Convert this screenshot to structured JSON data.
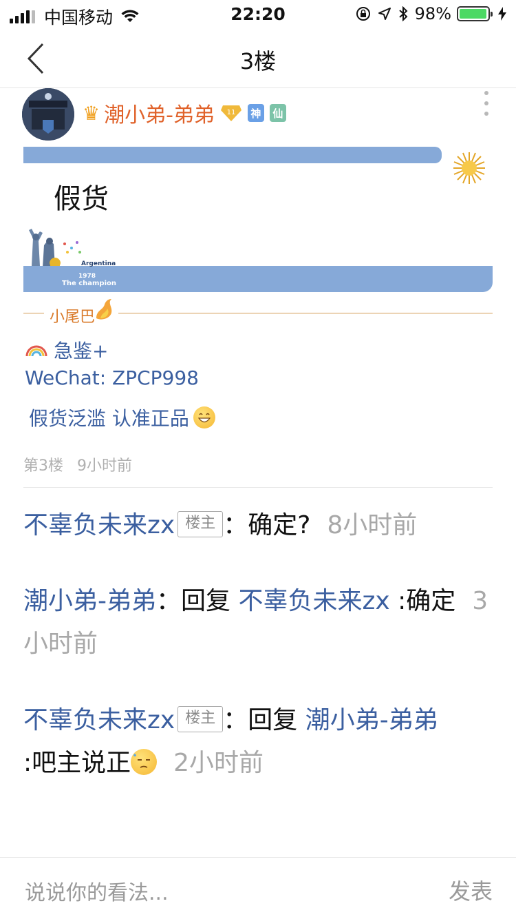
{
  "status_bar": {
    "carrier": "中国移动",
    "time": "22:20",
    "battery_percent": "98%",
    "battery_level": 0.98
  },
  "nav": {
    "title": "3楼"
  },
  "post": {
    "username": "潮小弟-弟弟",
    "level": "11",
    "badge1": "神",
    "badge2": "仙",
    "text": "假货",
    "signature_banner": {
      "country": "Argentina",
      "year": "1978",
      "caption": "The champion"
    },
    "tail_label": "小尾巴",
    "tail_line1": "急鉴+",
    "tail_line2": "WeChat: ZPCP998",
    "tail_line3": "假货泛滥 认准正品",
    "floor": "第3楼",
    "time": "9小时前"
  },
  "replies": [
    {
      "author": "不辜负未来zx",
      "badge": "楼主",
      "colon": "：",
      "text": "确定?",
      "time": "8小时前"
    },
    {
      "author": "潮小弟-弟弟",
      "colon": "：",
      "reply_prefix": "回复",
      "reply_to": "不辜负未来zx",
      "text": ":确定",
      "time": "3小时前"
    },
    {
      "author": "不辜负未来zx",
      "badge": "楼主",
      "colon": "：",
      "reply_prefix": "回复",
      "reply_to": "潮小弟-弟弟",
      "text": ":吧主说正",
      "time": "2小时前"
    }
  ],
  "input": {
    "placeholder": "说说你的看法...",
    "send_label": "发表"
  },
  "colors": {
    "link_blue": "#3b5fa0",
    "username_orange": "#e0622a",
    "banner_blue": "#86a9d8",
    "muted_gray": "#a8a8a8"
  }
}
